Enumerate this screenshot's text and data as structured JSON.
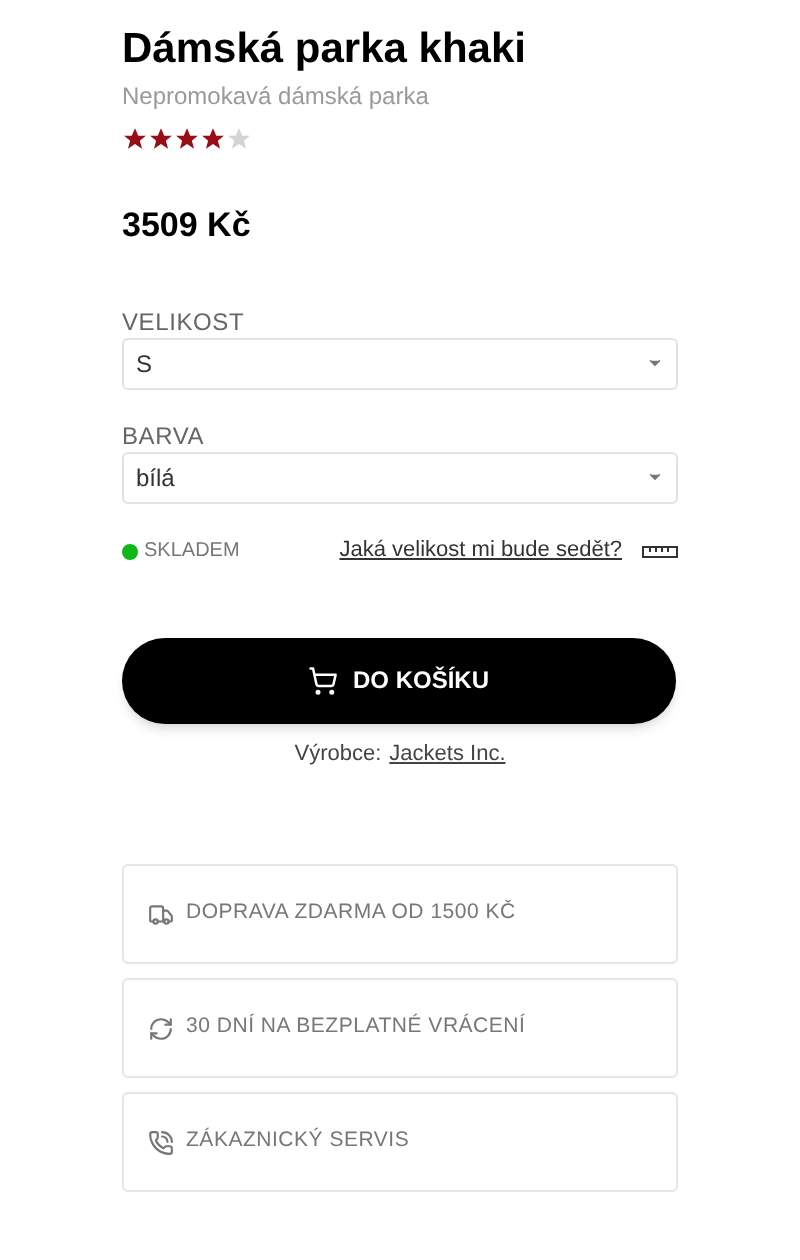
{
  "product": {
    "title": "Dámská parka khaki",
    "subtitle": "Nepromokavá dámská parka",
    "stars": 4,
    "price": "3509 Kč"
  },
  "options": [
    {
      "label": "VELIKOST",
      "value": "S"
    },
    {
      "label": "BARVA",
      "value": "bílá"
    }
  ],
  "availability": {
    "in_stock": true,
    "text": "SKLADEM"
  },
  "size_guide": "Jaká velikost mi bude sedět?",
  "cart_button": "DO KOŠÍKU",
  "manufacturer": {
    "label": "Výrobce:",
    "name": "Jackets Inc."
  },
  "features": [
    {
      "kind": "delivery",
      "text": "DOPRAVA ZDARMA OD 1500 KČ"
    },
    {
      "kind": "returns",
      "text": "30 DNÍ NA BEZPLATNÉ VRÁCENÍ"
    },
    {
      "kind": "service",
      "text": "ZÁKAZNICKÝ SERVIS"
    }
  ]
}
